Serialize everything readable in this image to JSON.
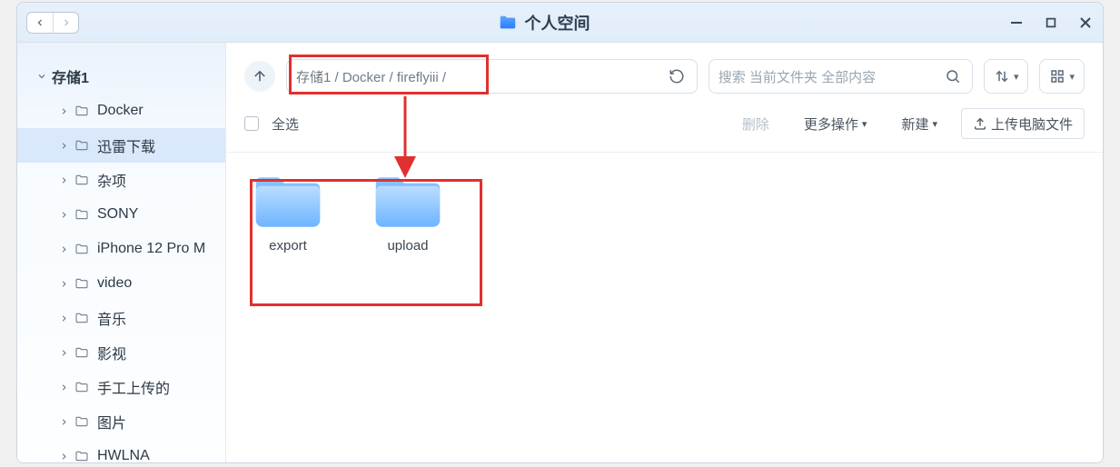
{
  "window": {
    "title": "个人空间"
  },
  "sidebar": {
    "root": {
      "label": "存储1"
    },
    "items": [
      {
        "label": "Docker"
      },
      {
        "label": "迅雷下载"
      },
      {
        "label": "杂项"
      },
      {
        "label": "SONY"
      },
      {
        "label": "iPhone 12 Pro M"
      },
      {
        "label": "video"
      },
      {
        "label": "音乐"
      },
      {
        "label": "影视"
      },
      {
        "label": "手工上传的"
      },
      {
        "label": "图片"
      },
      {
        "label": "HWLNA"
      }
    ],
    "selectedIndex": 1
  },
  "path": {
    "text": "存储1 / Docker / fireflyiii /"
  },
  "search": {
    "placeholder": "搜索 当前文件夹 全部内容"
  },
  "toolbar2": {
    "select_all": "全选",
    "delete": "删除",
    "more": "更多操作",
    "new": "新建",
    "upload": "上传电脑文件"
  },
  "content": {
    "items": [
      {
        "name": "export"
      },
      {
        "name": "upload"
      }
    ]
  }
}
